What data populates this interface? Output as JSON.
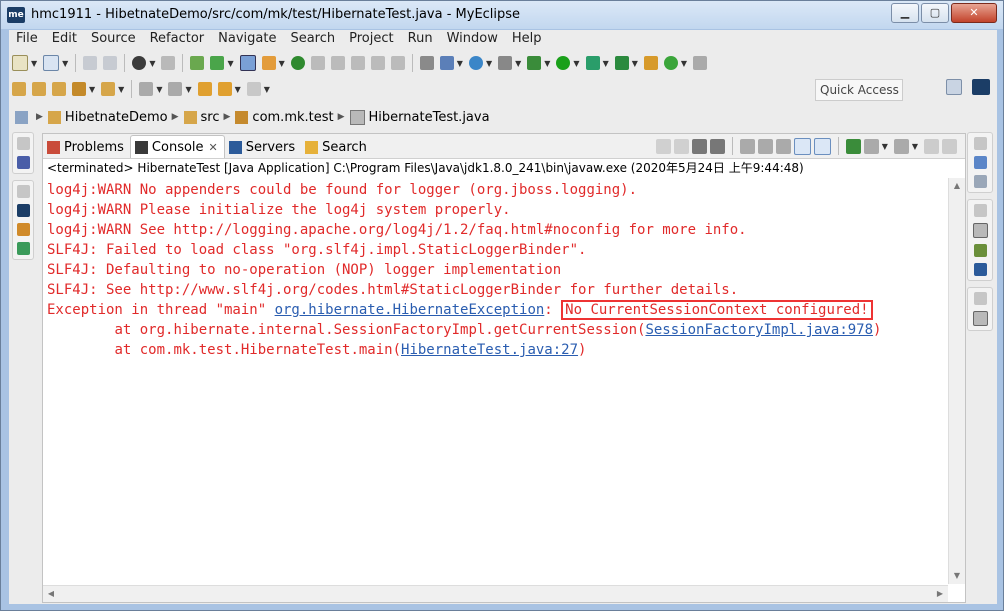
{
  "window": {
    "app_logo_text": "me",
    "title": "hmc1911 - HibetnateDemo/src/com/mk/test/HibernateTest.java - MyEclipse",
    "minimize_glyph": "▁",
    "maximize_glyph": "▢",
    "close_glyph": "✕"
  },
  "menu": [
    "File",
    "Edit",
    "Source",
    "Refactor",
    "Navigate",
    "Search",
    "Project",
    "Run",
    "Window",
    "Help"
  ],
  "quick_access": "Quick Access",
  "breadcrumb": {
    "project": "HibetnateDemo",
    "folder": "src",
    "package": "com.mk.test",
    "file": "HibernateTest.java"
  },
  "tabs": {
    "problems": "Problems",
    "console": "Console",
    "close_glyph": "✕",
    "servers": "Servers",
    "search": "Search"
  },
  "console": {
    "status": "<terminated> HibernateTest [Java Application] C:\\Program Files\\Java\\jdk1.8.0_241\\bin\\javaw.exe (2020年5月24日 上午9:44:48)",
    "line1": "log4j:WARN No appenders could be found for logger (org.jboss.logging).",
    "line2": "log4j:WARN Please initialize the log4j system properly.",
    "line3": "log4j:WARN See http://logging.apache.org/log4j/1.2/faq.html#noconfig for more info.",
    "line4": "SLF4J: Failed to load class \"org.slf4j.impl.StaticLoggerBinder\".",
    "line5": "SLF4J: Defaulting to no-operation (NOP) logger implementation",
    "line6": "SLF4J: See http://www.slf4j.org/codes.html#StaticLoggerBinder for further details.",
    "exc_prefix": "Exception in thread \"main\" ",
    "exc_class": "org.hibernate.HibernateException",
    "exc_colon": ": ",
    "exc_message": "No CurrentSessionContext configured!",
    "st1_prefix": "\tat org.hibernate.internal.SessionFactoryImpl.getCurrentSession(",
    "st1_link": "SessionFactoryImpl.java:978",
    "st1_suffix": ")",
    "st2_prefix": "\tat com.mk.test.HibernateTest.main(",
    "st2_link": "HibernateTest.java:27",
    "st2_suffix": ")"
  }
}
